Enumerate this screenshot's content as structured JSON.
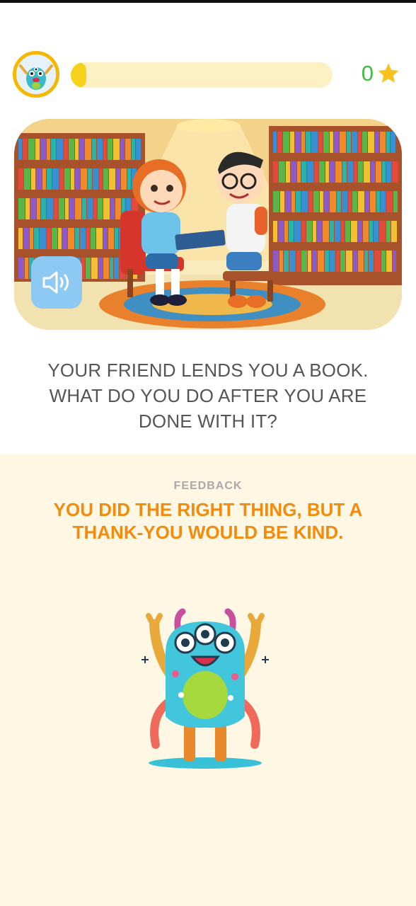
{
  "header": {
    "avatar_icon": "monster-avatar-icon",
    "progress_fraction": 0.06,
    "score": "0",
    "score_icon": "star-icon",
    "accent_color": "#f5b800",
    "score_color": "#3cbf3c"
  },
  "scene": {
    "image": "kids-library-book-illustration",
    "sound_icon": "speaker-icon"
  },
  "question": {
    "text": "YOUR FRIEND LENDS YOU A BOOK. WHAT DO YOU DO AFTER YOU ARE DONE WITH IT?"
  },
  "feedback": {
    "label": "FEEDBACK",
    "message": "YOU DID THE RIGHT THING, BUT A THANK-YOU WOULD BE KIND.",
    "panel_color": "#fdf7e3",
    "message_color": "#f28c0f",
    "mascot": "monster-mascot"
  }
}
